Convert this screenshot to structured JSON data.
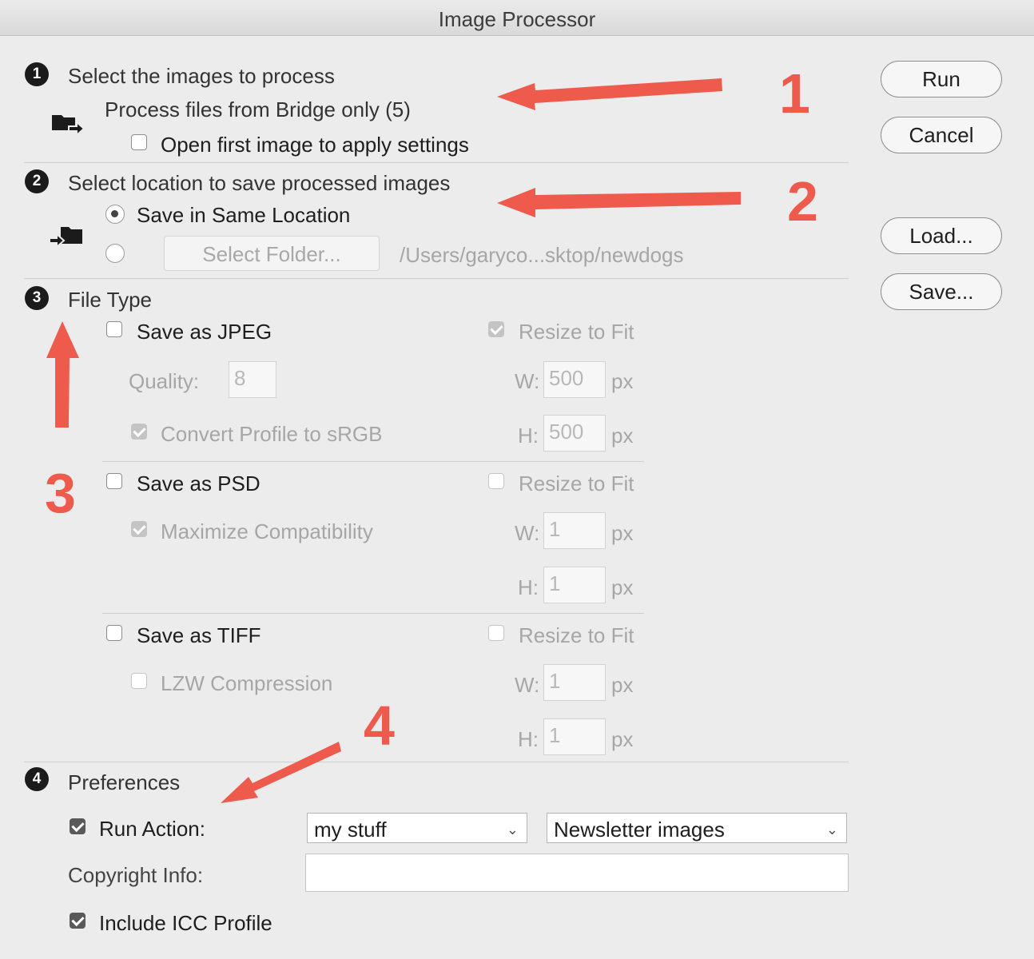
{
  "window": {
    "title": "Image Processor"
  },
  "buttons": {
    "run": "Run",
    "cancel": "Cancel",
    "load": "Load...",
    "save": "Save..."
  },
  "section1": {
    "step": "1",
    "heading": "Select the images to process",
    "source": "Process files from Bridge only (5)",
    "open_first_label": "Open first image to apply settings",
    "open_first_checked": false
  },
  "section2": {
    "step": "2",
    "heading": "Select location to save processed images",
    "same_location_label": "Save in Same Location",
    "same_location_selected": true,
    "select_folder_label": "Select Folder...",
    "folder_path": "/Users/garyco...sktop/newdogs"
  },
  "section3": {
    "step": "3",
    "heading": "File Type",
    "jpeg": {
      "label": "Save as JPEG",
      "checked": false,
      "quality_label": "Quality:",
      "quality": "8",
      "convert_label": "Convert Profile to sRGB",
      "convert_checked": true,
      "resize_label": "Resize to Fit",
      "resize_checked": true,
      "w_label": "W:",
      "w": "500",
      "h_label": "H:",
      "h": "500",
      "unit": "px"
    },
    "psd": {
      "label": "Save as PSD",
      "checked": false,
      "maximize_label": "Maximize Compatibility",
      "maximize_checked": true,
      "resize_label": "Resize to Fit",
      "resize_checked": false,
      "w_label": "W:",
      "w": "1",
      "h_label": "H:",
      "h": "1",
      "unit": "px"
    },
    "tiff": {
      "label": "Save as TIFF",
      "checked": false,
      "lzw_label": "LZW Compression",
      "lzw_checked": false,
      "resize_label": "Resize to Fit",
      "resize_checked": false,
      "w_label": "W:",
      "w": "1",
      "h_label": "H:",
      "h": "1",
      "unit": "px"
    }
  },
  "section4": {
    "step": "4",
    "heading": "Preferences",
    "run_action_label": "Run Action:",
    "run_action_checked": true,
    "action_set": "my stuff",
    "action": "Newsletter images",
    "copyright_label": "Copyright Info:",
    "copyright_value": "",
    "icc_label": "Include ICC Profile",
    "icc_checked": true
  },
  "annotations": {
    "color": "#ee5a4c",
    "labels": [
      "1",
      "2",
      "3",
      "4"
    ]
  }
}
